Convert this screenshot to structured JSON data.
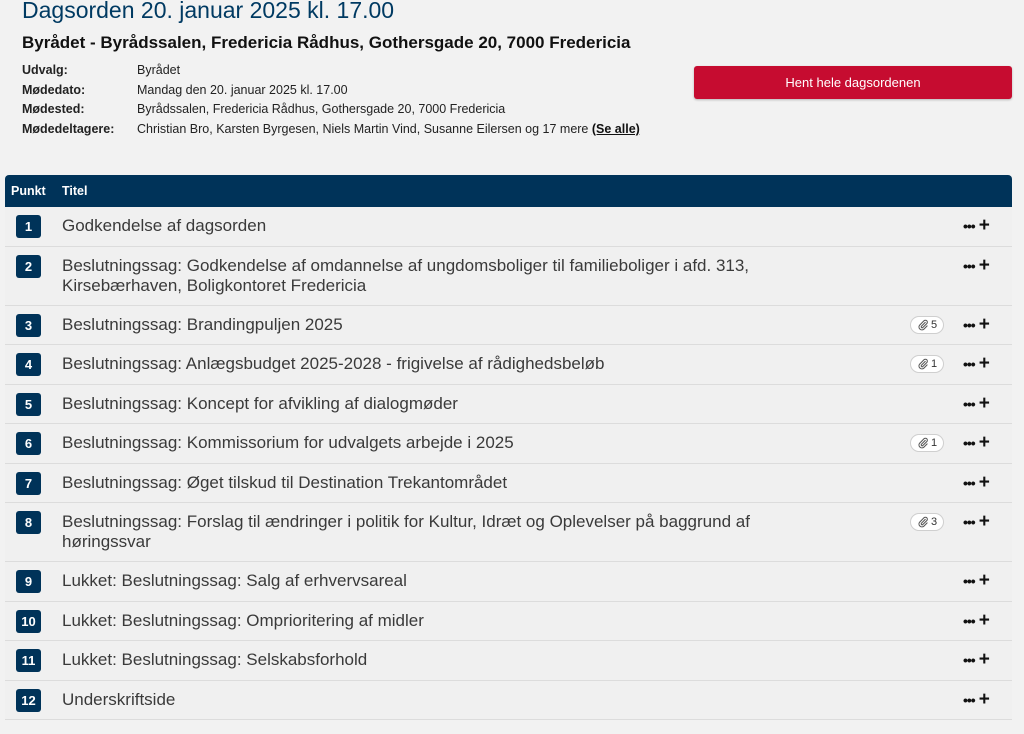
{
  "header": {
    "title": "Dagsorden 20. januar 2025 kl. 17.00",
    "subtitle": "Byrådet - Byrådssalen, Fredericia Rådhus, Gothersgade 20, 7000 Fredericia"
  },
  "meta": {
    "udvalg_label": "Udvalg:",
    "udvalg": "Byrådet",
    "modedato_label": "Mødedato:",
    "modedato": "Mandag den 20. januar 2025 kl. 17.00",
    "modested_label": "Mødested:",
    "modested": "Byrådssalen, Fredericia Rådhus, Gothersgade 20, 7000 Fredericia",
    "deltagere_label": "Mødedeltagere:",
    "deltagere": "Christian Bro, Karsten Byrgesen, Niels Martin Vind, Susanne Eilersen og 17 mere",
    "see_all": "(Se alle)"
  },
  "actions": {
    "hent_label": "Hent hele dagsordenen"
  },
  "table": {
    "col_punkt": "Punkt",
    "col_titel": "Titel"
  },
  "items": [
    {
      "num": "1",
      "title": "Godkendelse af dagsorden",
      "attachments": null
    },
    {
      "num": "2",
      "title": "Beslutningssag: Godkendelse af omdannelse af ungdomsboliger til familieboliger i afd. 313, Kirsebærhaven, Boligkontoret Fredericia",
      "attachments": null
    },
    {
      "num": "3",
      "title": "Beslutningssag: Brandingpuljen 2025",
      "attachments": "5"
    },
    {
      "num": "4",
      "title": "Beslutningssag: Anlægsbudget 2025-2028 - frigivelse af rådighedsbeløb",
      "attachments": "1"
    },
    {
      "num": "5",
      "title": "Beslutningssag: Koncept for afvikling af dialogmøder",
      "attachments": null
    },
    {
      "num": "6",
      "title": "Beslutningssag: Kommissorium for udvalgets arbejde i 2025",
      "attachments": "1"
    },
    {
      "num": "7",
      "title": "Beslutningssag: Øget tilskud til Destination Trekantområdet",
      "attachments": null
    },
    {
      "num": "8",
      "title": "Beslutningssag: Forslag til ændringer i politik for Kultur, Idræt og Oplevelser på baggrund af høringssvar",
      "attachments": "3"
    },
    {
      "num": "9",
      "title": "Lukket: Beslutningssag: Salg af erhvervsareal",
      "attachments": null
    },
    {
      "num": "10",
      "title": "Lukket: Beslutningssag: Omprioritering af midler",
      "attachments": null
    },
    {
      "num": "11",
      "title": "Lukket: Beslutningssag: Selskabsforhold",
      "attachments": null
    },
    {
      "num": "12",
      "title": "Underskriftside",
      "attachments": null
    }
  ],
  "icons": {
    "more": "ellipsis-icon",
    "add": "plus-icon",
    "attachment": "paperclip-icon"
  },
  "colors": {
    "primary": "#003359",
    "title": "#003a62",
    "button": "#c60c30"
  }
}
